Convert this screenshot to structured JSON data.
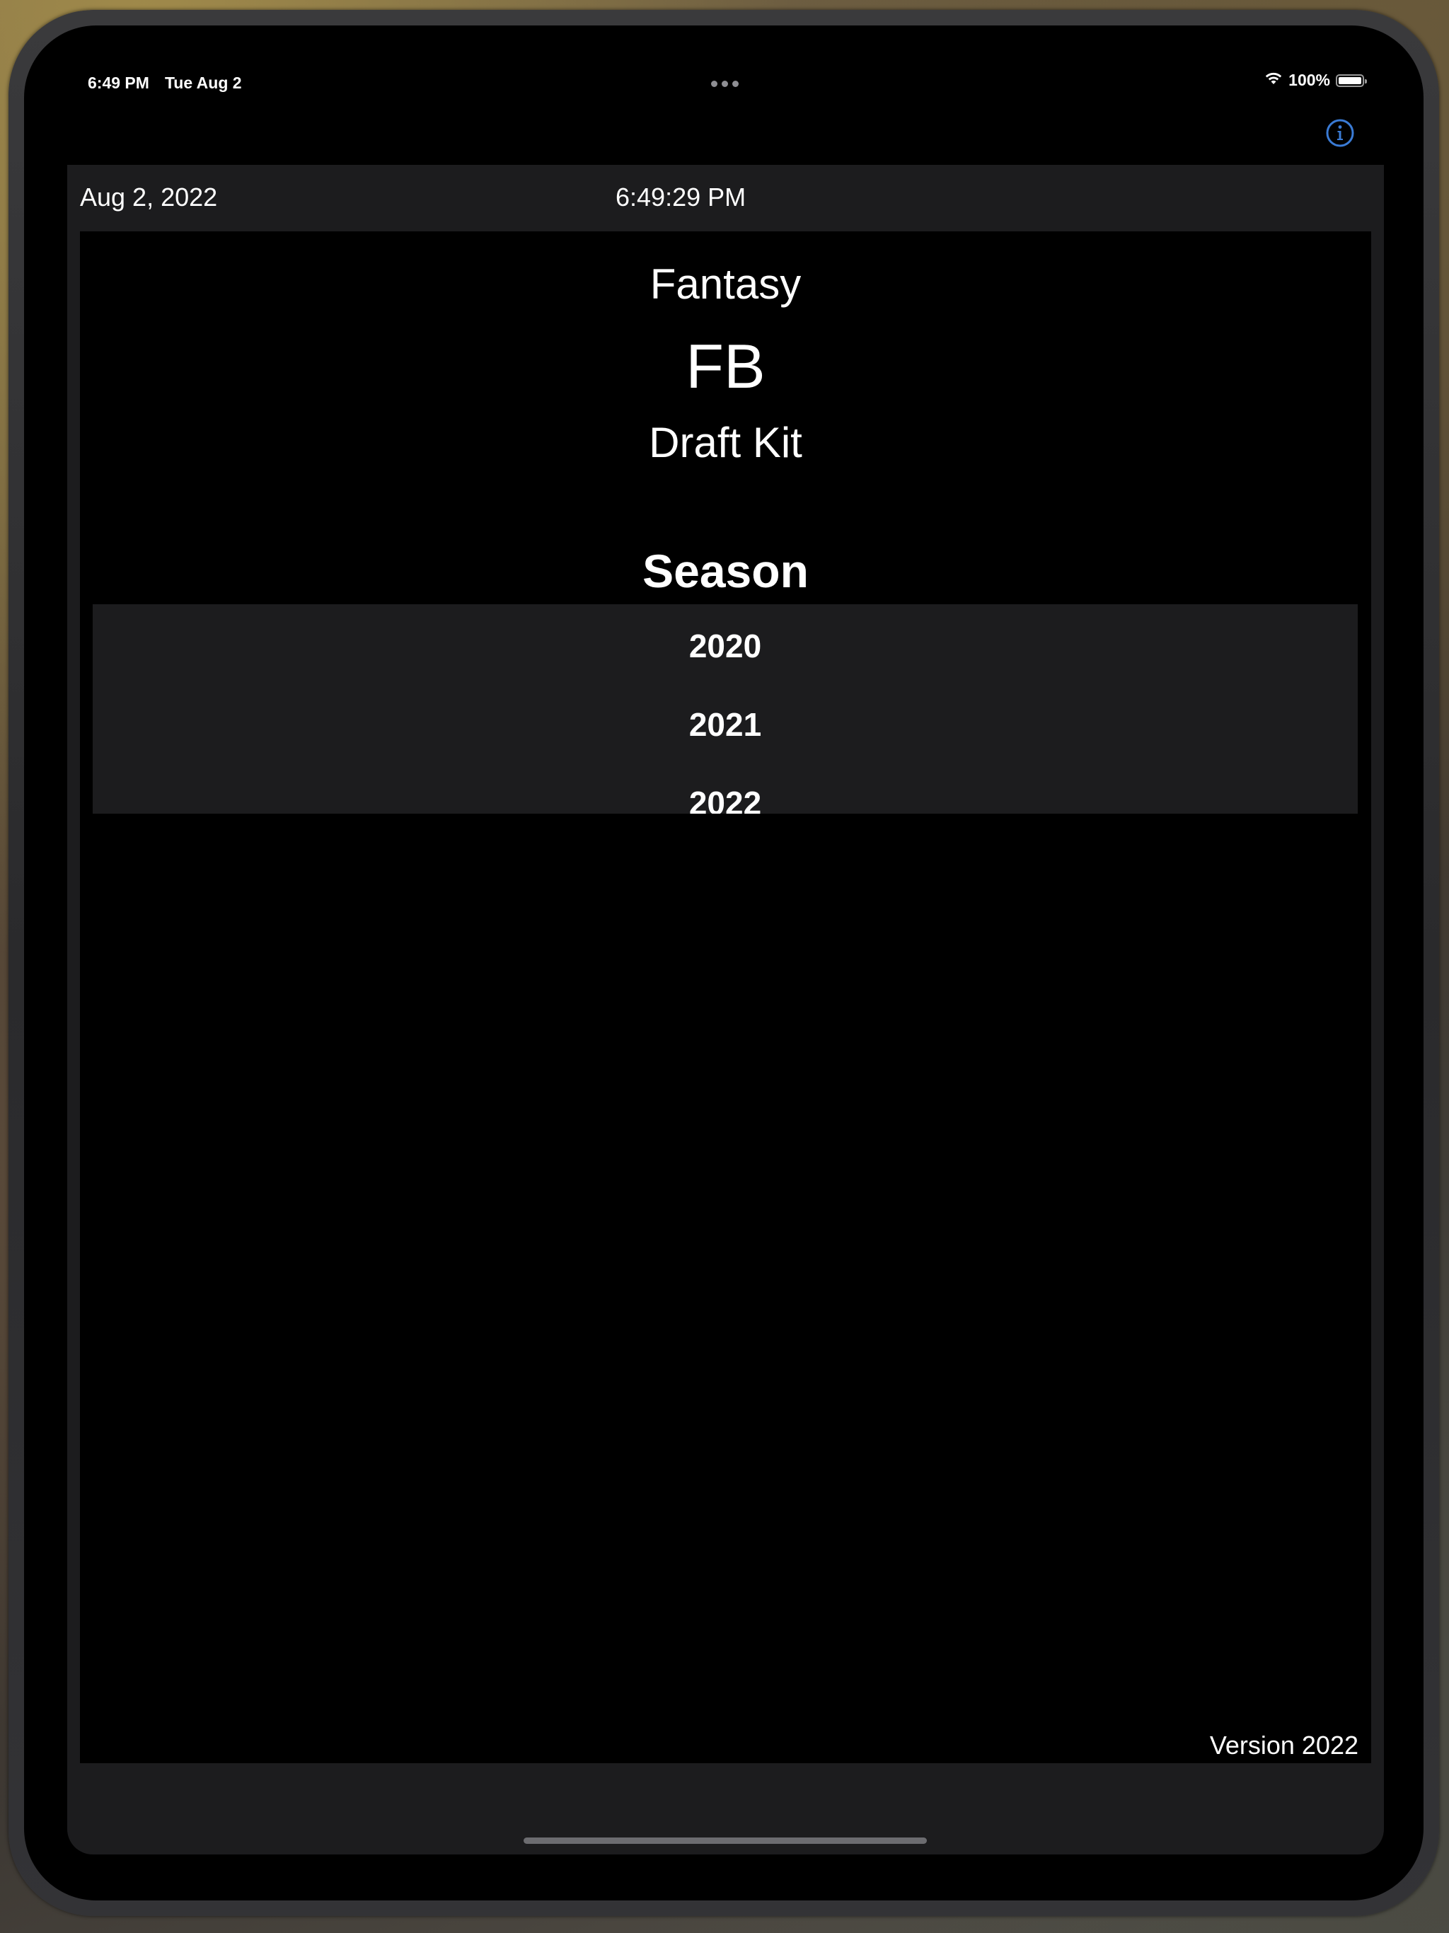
{
  "status_bar": {
    "time": "6:49 PM",
    "date": "Tue Aug 2",
    "battery": "100%",
    "battery_level": 1.0,
    "icons": [
      "multitasking-dots-icon",
      "wifi-icon",
      "battery-icon"
    ]
  },
  "nav": {
    "info_icon": "info-circle-icon",
    "accent_color": "#3a7bd5"
  },
  "header": {
    "date": "Aug 2, 2022",
    "time": "6:49:29 PM"
  },
  "title": {
    "line1": "Fantasy",
    "line2": "FB",
    "line3": "Draft Kit"
  },
  "season": {
    "label": "Season",
    "options": [
      "2020",
      "2021",
      "2022"
    ]
  },
  "footer": {
    "version": "Version 2022"
  },
  "colors": {
    "panel": "#1c1c1e",
    "background": "#000000",
    "text": "#ffffff"
  }
}
